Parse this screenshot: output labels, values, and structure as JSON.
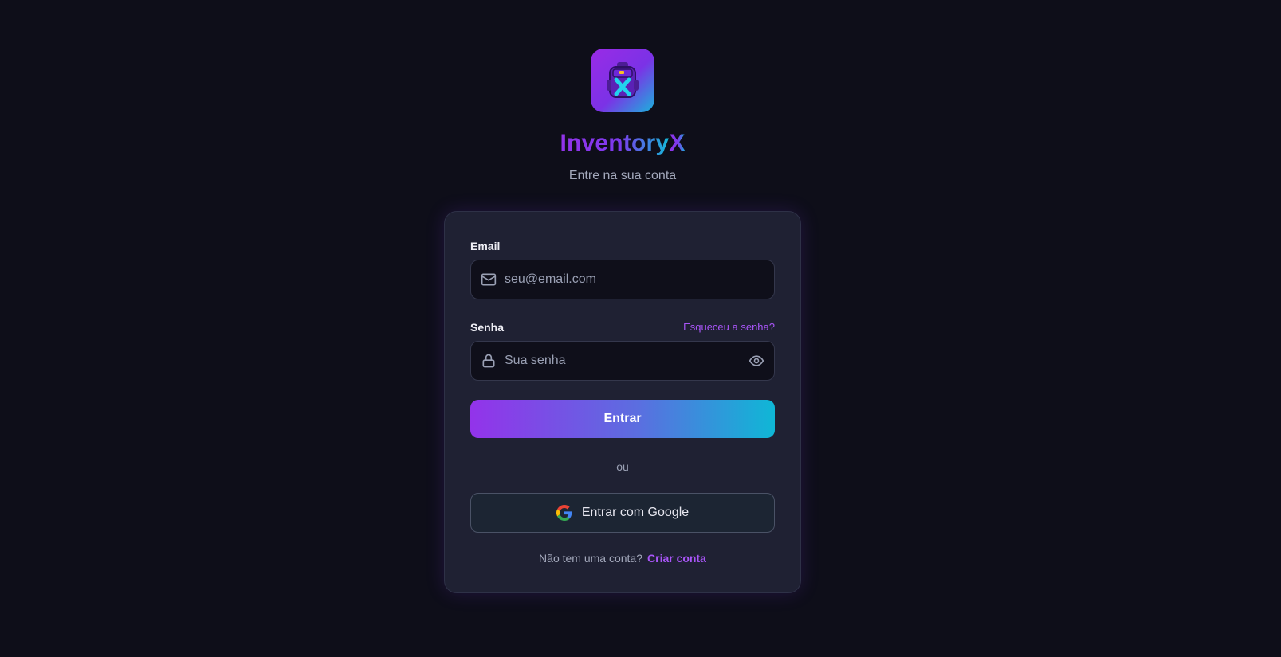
{
  "app": {
    "name_main": "Inventory",
    "name_accent": "X",
    "subtitle": "Entre na sua conta",
    "logo_icon": "backpack-icon"
  },
  "colors": {
    "background": "#0e0e19",
    "card": "#1f2133",
    "accent_purple": "#9333ea",
    "accent_cyan": "#14b8d8",
    "link": "#a855f7"
  },
  "form": {
    "email": {
      "label": "Email",
      "placeholder": "seu@email.com",
      "value": "",
      "icon": "mail-icon"
    },
    "password": {
      "label": "Senha",
      "placeholder": "Sua senha",
      "value": "",
      "icon": "lock-icon",
      "toggle_icon": "eye-icon",
      "forgot_label": "Esqueceu a senha?"
    },
    "submit_label": "Entrar",
    "divider_label": "ou",
    "google_label": "Entrar com Google",
    "google_icon": "google-icon",
    "signup_prompt": "Não tem uma conta?",
    "signup_link": "Criar conta"
  }
}
